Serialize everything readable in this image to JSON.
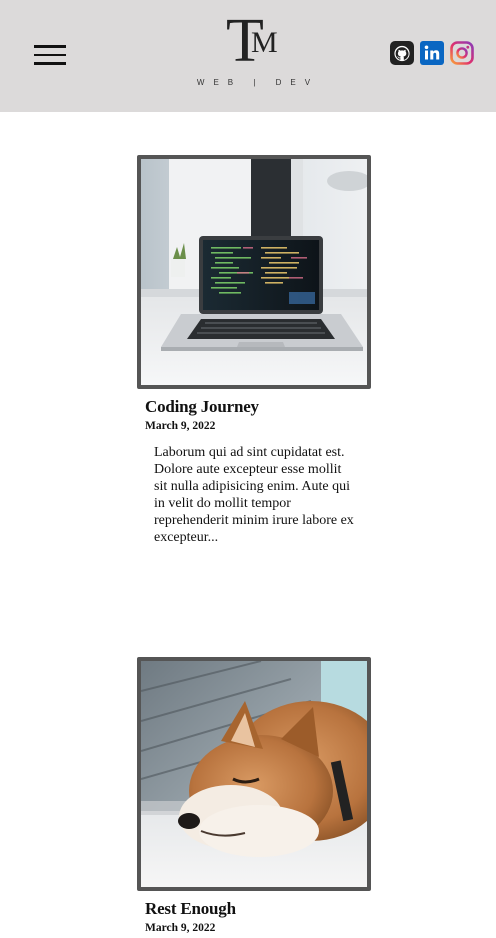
{
  "header": {
    "logo_initial_t": "T",
    "logo_initial_m": "M",
    "logo_tagline": "WEB | DEV",
    "social": [
      "github-icon",
      "linkedin-icon",
      "instagram-icon"
    ],
    "colors": {
      "header_bg": "#dcdada",
      "linkedin": "#0a66c2"
    }
  },
  "posts": [
    {
      "title": "Coding Journey",
      "date": "March 9, 2022",
      "excerpt": "Laborum qui ad sint cupidatat est. Dolore aute excepteur esse mollit sit nulla adipisicing enim. Aute qui in velit do mollit tempor reprehenderit minim irure labore ex excepteur..."
    },
    {
      "title": "Rest Enough",
      "date": "March 9, 2022"
    }
  ]
}
